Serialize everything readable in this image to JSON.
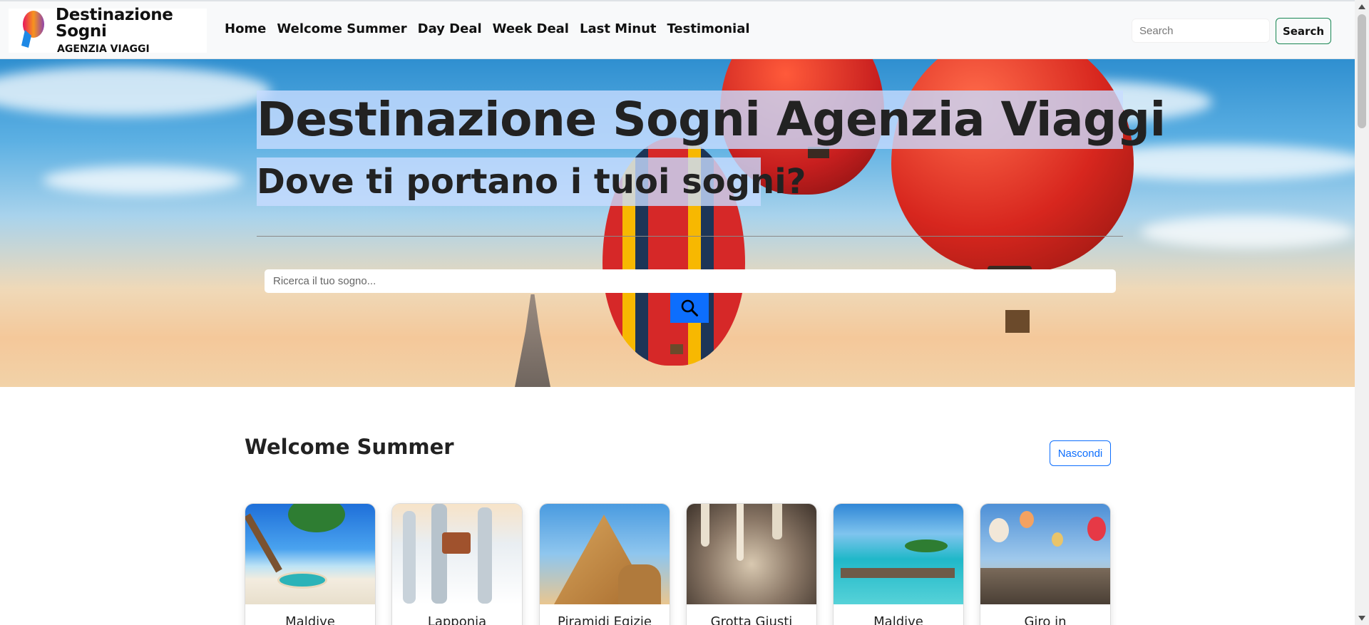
{
  "brand": {
    "title": "Destinazione Sogni",
    "subtitle": "AGENZIA VIAGGI"
  },
  "nav": {
    "links": [
      "Home",
      "Welcome Summer",
      "Day Deal",
      "Week Deal",
      "Last Minut",
      "Testimonial"
    ],
    "search_placeholder": "Search",
    "search_button": "Search"
  },
  "hero": {
    "title": "Destinazione Sogni Agenzia Viaggi",
    "subtitle": "Dove ti portano i tuoi sogni?",
    "search_placeholder": "Ricerca il tuo sogno...",
    "search_icon": "search-icon"
  },
  "section": {
    "title": "Welcome Summer",
    "toggle_button": "Nascondi",
    "cards": [
      {
        "title": "Maldive",
        "image": "beach-hammock"
      },
      {
        "title": "Lapponia",
        "image": "snowy-forest"
      },
      {
        "title": "Piramidi Egizie",
        "image": "pyramids-sphinx"
      },
      {
        "title": "Grotta Giusti",
        "image": "cave"
      },
      {
        "title": "Maldive",
        "image": "water-bungalows"
      },
      {
        "title": "Giro in",
        "image": "balloons-city"
      }
    ]
  },
  "colors": {
    "primary": "#0d6efd",
    "success": "#198754",
    "nav_bg": "#f8f9fa"
  }
}
